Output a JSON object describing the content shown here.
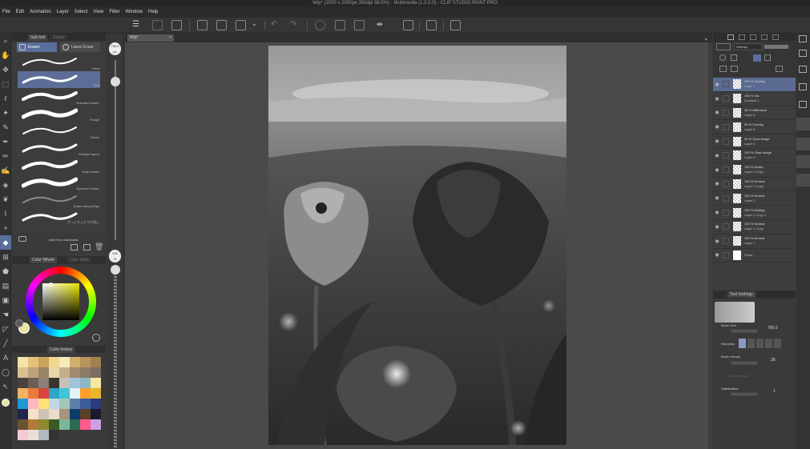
{
  "title": "Wip* (1500 x 2000px 350dpi 38.5%) - Multimedia (1.2.0.0) - CLIP STUDIO PAINT PRO",
  "menu": [
    "File",
    "Edit",
    "Animation",
    "Layer",
    "Select",
    "View",
    "Filter",
    "Window",
    "Help"
  ],
  "subtool": {
    "tabs": [
      "Sub tool",
      "Eraser"
    ],
    "eraser_tabs": [
      "Eraser",
      "Lasso Erase"
    ],
    "brushes": [
      {
        "name": "Hard"
      },
      {
        "name": "Soft"
      },
      {
        "name": "Kneaded eraser"
      },
      {
        "name": "Rough"
      },
      {
        "name": "Vector"
      },
      {
        "name": "Multiple layers"
      },
      {
        "name": "Snap eraser"
      },
      {
        "name": "Dynamic Eraser"
      },
      {
        "name": "Erase Along Edge"
      },
      {
        "name": "ざっくりしたつけ消し"
      }
    ],
    "footer_label": "Add from downloads"
  },
  "size_readout": "700.0",
  "size_unit": "px",
  "opacity_readout": "100",
  "opacity_unit": "%",
  "color_tabs": [
    "Color Wheel",
    "Color Slider"
  ],
  "palette_tabs": [
    "Color history"
  ],
  "palette_colors": [
    "#f3e3a8",
    "#e2c27a",
    "#c9a25c",
    "#f0d88f",
    "#f7ecb8",
    "#cfae6e",
    "#b8955b",
    "#a48050",
    "#d8c090",
    "#bca27a",
    "#9a8468",
    "#e7d6a8",
    "#c3b08a",
    "#a18b6c",
    "#8b7a66",
    "#7a6e63",
    "#4a423c",
    "#6a5f58",
    "#8d8078",
    "#3b3532",
    "#c7c0b8",
    "#9ec4d6",
    "#8cb8c6",
    "#f5e9a0",
    "#f1b460",
    "#e77c3c",
    "#d9443e",
    "#2aa6c9",
    "#3fc6d8",
    "#e4f1f6",
    "#ff9e2a",
    "#e7b62c",
    "#1d9ad6",
    "#fdb6c4",
    "#ffe27a",
    "#bfd6e6",
    "#a4c6b8",
    "#5f7fa8",
    "#3b5d9c",
    "#2d3b7a",
    "#21254a",
    "#f5e0c8",
    "#ccc2b6",
    "#e8ddc9",
    "#a8937c",
    "#0b3c6a",
    "#5a4128",
    "#1a1a2a",
    "#6b5231",
    "#b07a3a",
    "#8c8a2e",
    "#3a5a2a",
    "#7ab89a",
    "#2d6b52",
    "#ff5a8a",
    "#c9a0e8",
    "#f3c9d6",
    "#e8e0d8",
    "#b0b8c0",
    "#333333"
  ],
  "document_tab": "Wip*",
  "layers": [
    {
      "blend": "100 % Overlay",
      "name": "Layer 7",
      "selected": true
    },
    {
      "blend": "100 % Sol...",
      "name": "Gradient 1",
      "selected": false
    },
    {
      "blend": "46 % Difference",
      "name": "Layer 8",
      "selected": false
    },
    {
      "blend": "65 % Overlay",
      "name": "Layer 6",
      "selected": false
    },
    {
      "blend": "31 % Glow dodge",
      "name": "Layer 4",
      "selected": false
    },
    {
      "blend": "100 % Glow dodge",
      "name": "Layer 3",
      "selected": false
    },
    {
      "blend": "100 % Divide",
      "name": "Layer 4 Copy",
      "selected": false
    },
    {
      "blend": "100 % Normal",
      "name": "Layer 2 Copy",
      "selected": false
    },
    {
      "blend": "100 % Normal",
      "name": "Layer 2",
      "selected": false
    },
    {
      "blend": "100 % Multiply",
      "name": "Layer 1 Copy 2",
      "selected": false
    },
    {
      "blend": "100 % Normal",
      "name": "Layer 1 Copy",
      "selected": false
    },
    {
      "blend": "100 % Normal",
      "name": "Layer 1",
      "selected": false
    },
    {
      "blend": "",
      "name": "Paper",
      "selected": false
    }
  ],
  "layer_blend_mode": "Overlay",
  "tool_property": {
    "tab": "Tool Settings",
    "brush_size_label": "Brush Size",
    "brush_size_value": "700.0",
    "hardness_label": "Hardness",
    "brush_density_label": "Brush density",
    "brush_density_value": "28",
    "vector_eraser_label": "Vector eraser",
    "stabilization_label": "Stabilization",
    "stabilization_value": "1"
  },
  "colors": {
    "accent": "#5a6e9b",
    "panel": "#3a3a3a",
    "main_color": "#e7e4a1"
  }
}
